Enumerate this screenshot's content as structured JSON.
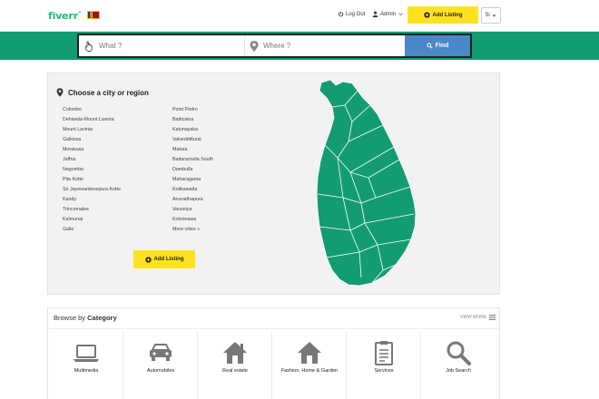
{
  "header": {
    "logo": "fiverr",
    "logo_mark": "®",
    "logout": "Log Out",
    "admin": "Admin",
    "add_listing": "Add Listing",
    "lang": "Si"
  },
  "search": {
    "what_placeholder": "What ?",
    "where_placeholder": "Where ?",
    "find_label": "Find"
  },
  "cities": {
    "heading": "Choose a city or region",
    "column_a": [
      "Colombo",
      "Dehiwala-Mount Lavinia",
      "Mount Lavinia",
      "Galkissa",
      "Moratuwa",
      "Jaffna",
      "Negombo",
      "Pita Kotte",
      "Sri Jayewardenepura Kotte",
      "Kandy",
      "Trincomalee",
      "Kalmunai",
      "Galle"
    ],
    "column_b": [
      "Point Pedro",
      "Batticaloa",
      "Katunayaka",
      "Valvedditturai",
      "Matara",
      "Battaramulla South",
      "Dambulla",
      "Maharagama",
      "Kotikawatta",
      "Anuradhapura",
      "Vavuniya",
      "Kolonnawa",
      "More cities »"
    ],
    "add_listing": "Add Listing"
  },
  "map": {
    "fill": "#139c72",
    "stroke": "#ffffff"
  },
  "categories": {
    "browse": "Browse by",
    "title": "Category",
    "view_more": "VIEW MORE",
    "items": [
      {
        "label": "Multimedia",
        "icon": "laptop-icon"
      },
      {
        "label": "Automobiles",
        "icon": "car-icon"
      },
      {
        "label": "Real estate",
        "icon": "house-icon"
      },
      {
        "label": "Fashion, Home & Garden",
        "icon": "home-icon"
      },
      {
        "label": "Services",
        "icon": "clipboard-icon"
      },
      {
        "label": "Job Search",
        "icon": "magnifier-icon"
      }
    ]
  },
  "colors": {
    "brand_green": "#129c72",
    "accent_yellow": "#ffe21f",
    "find_blue": "#4a88c7"
  }
}
